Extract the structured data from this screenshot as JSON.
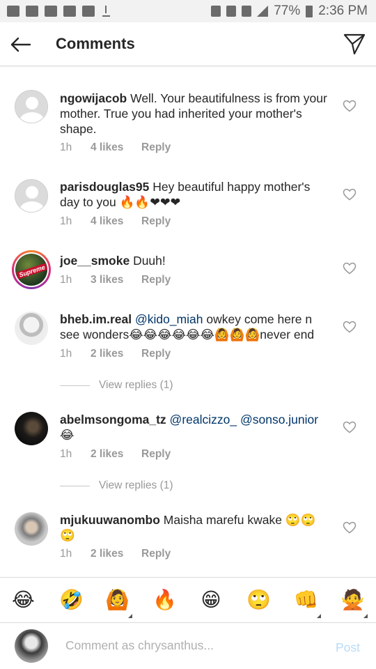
{
  "status_bar": {
    "battery": "77%",
    "time": "2:36 PM"
  },
  "header": {
    "title": "Comments"
  },
  "comments": [
    {
      "username": "ngowijacob",
      "text": " Well. Your beautifulness is from your mother. True you had inherited your mother's shape.",
      "time": "1h",
      "likes": "4 likes",
      "reply": "Reply"
    },
    {
      "username": "parisdouglas95",
      "text": " Hey beautiful happy mother's day to you 🔥🔥❤❤❤",
      "time": "1h",
      "likes": "4 likes",
      "reply": "Reply"
    },
    {
      "username": "joe__smoke",
      "text": " Duuh!",
      "time": "1h",
      "likes": "3 likes",
      "reply": "Reply",
      "avatar_badge": "Supreme"
    },
    {
      "username": "bheb.im.real",
      "mention": " @kido_miah",
      "text": " owkey come here n see wonders😂😂😂😂😂😂🙆🙆🙆never end",
      "time": "1h",
      "likes": "2 likes",
      "reply": "Reply",
      "view_replies": "View replies (1)"
    },
    {
      "username": "abelmsongoma_tz",
      "mention": " @realcizzo_  @sonso.junior",
      "text": " 😂",
      "time": "1h",
      "likes": "2 likes",
      "reply": "Reply",
      "view_replies": "View replies (1)"
    },
    {
      "username": "mjukuuwanombo",
      "text": " Maisha marefu kwake 🙄🙄🙄",
      "time": "1h",
      "likes": "2 likes",
      "reply": "Reply"
    }
  ],
  "emoji_bar": [
    "😂",
    "🤣",
    "🙆",
    "🔥",
    "😁",
    "🙄",
    "👊",
    "🙅"
  ],
  "composer": {
    "placeholder": "Comment as chrysanthus...",
    "post_label": "Post"
  },
  "colors": {
    "mention": "#003569",
    "meta": "#999999",
    "post_disabled": "#b6dcf7",
    "divider": "#dbdbdb"
  }
}
